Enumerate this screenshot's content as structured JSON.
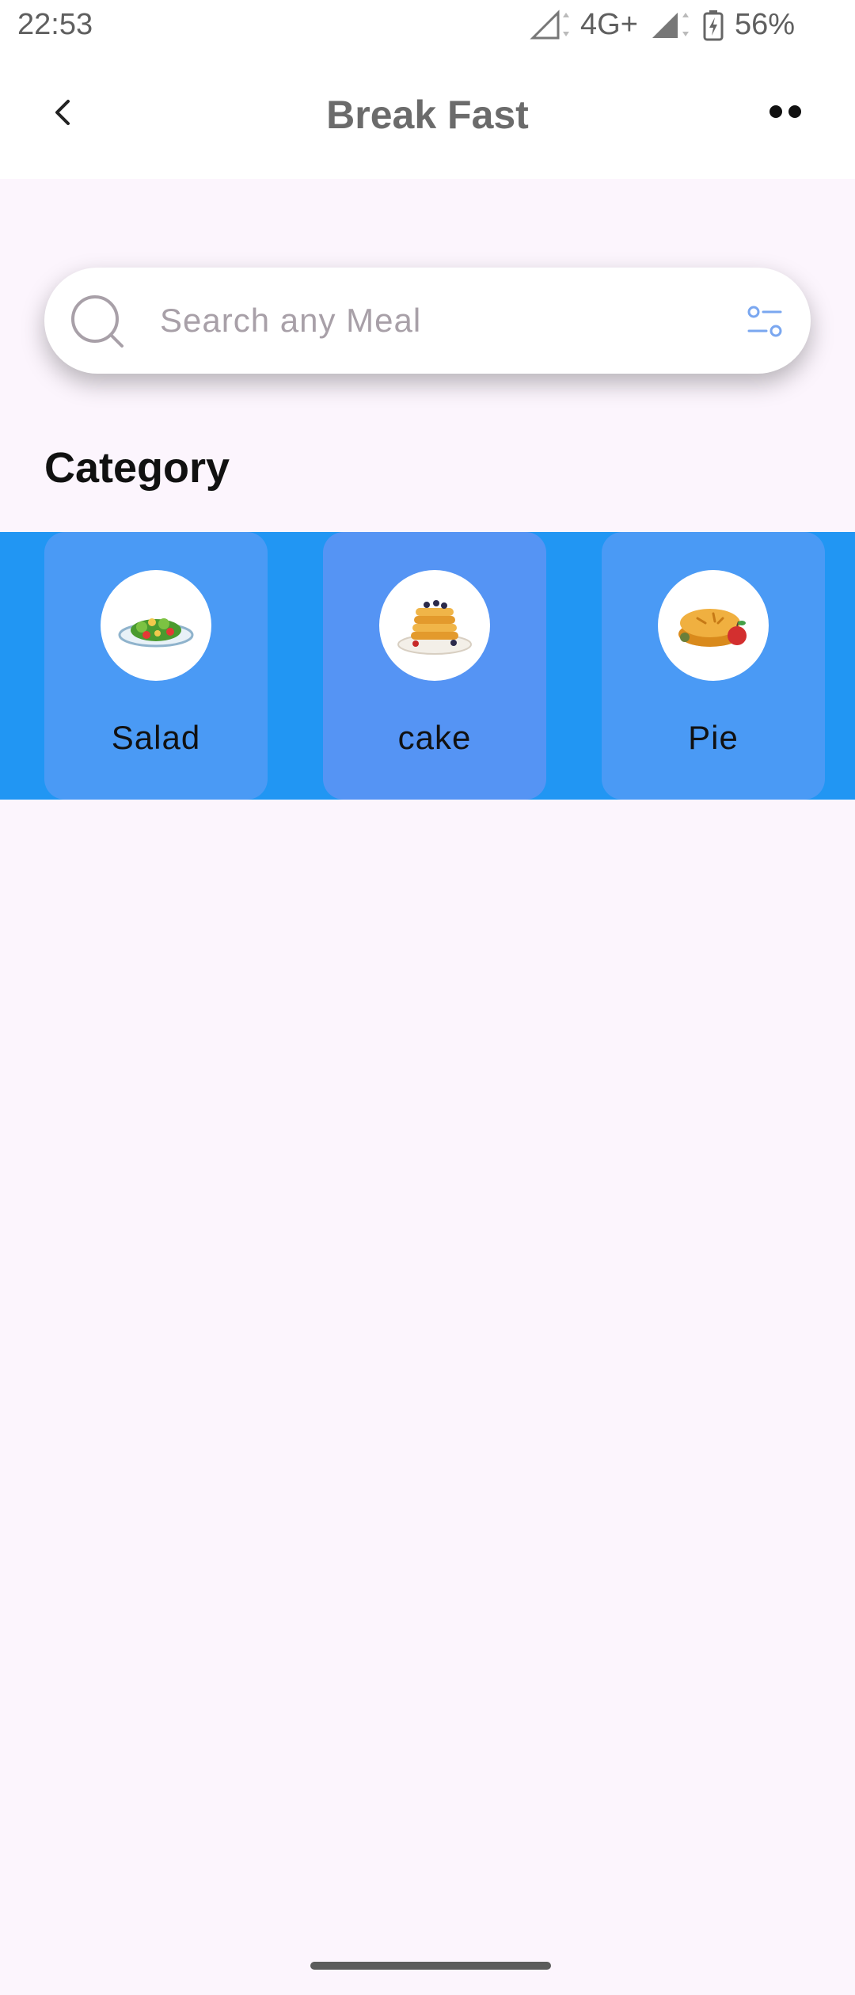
{
  "status_bar": {
    "time": "22:53",
    "network": "4G+",
    "battery": "56%",
    "icons": [
      "signal-empty-icon",
      "signal-full-icon",
      "battery-charging-icon"
    ]
  },
  "header": {
    "title": "Break Fast",
    "back_icon": "chevron-left-icon",
    "more_icon": "more-dots-icon"
  },
  "search": {
    "placeholder": "Search any Meal",
    "value": "",
    "icon": "search-icon",
    "filter_icon": "filter-sliders-icon"
  },
  "category": {
    "title": "Category",
    "items": [
      {
        "label": "Salad",
        "icon": "salad-icon",
        "selected": false
      },
      {
        "label": "cake",
        "icon": "pancake-icon",
        "selected": true
      },
      {
        "label": "Pie",
        "icon": "pie-icon",
        "selected": false
      }
    ]
  },
  "colors": {
    "accent": "#2196f3",
    "card": "#4a9af5",
    "card_selected": "#5594f4",
    "background": "#fcf5fd",
    "filter_icon": "#7aa7f0"
  }
}
